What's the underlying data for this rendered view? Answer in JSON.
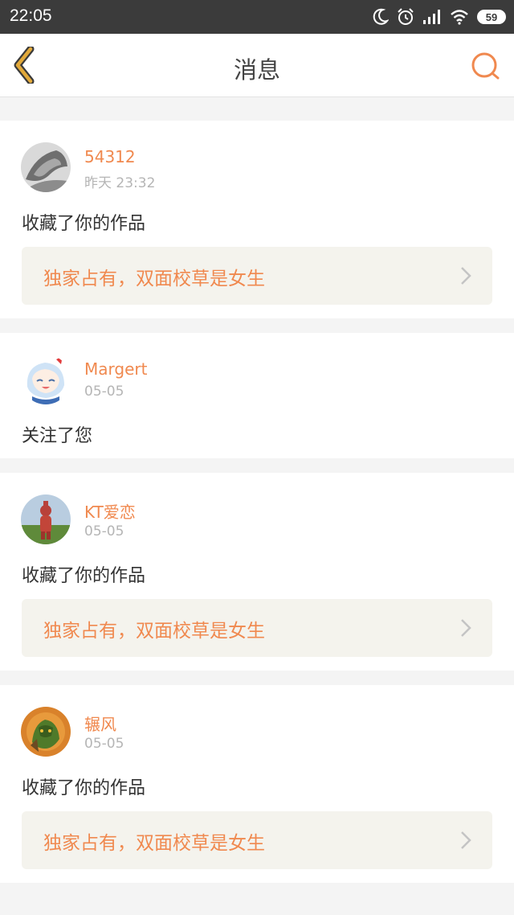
{
  "status_bar": {
    "time": "22:05",
    "icons": [
      "moon-icon",
      "alarm-icon",
      "signal-icon",
      "wifi-icon",
      "battery-icon"
    ],
    "battery": "59"
  },
  "header": {
    "title": "消息",
    "back_icon": "chevron-left-icon",
    "search_icon": "search-icon"
  },
  "colors": {
    "accent": "#f0894f",
    "back_icon": "#e2a93a",
    "secondary_text": "#b5b5b5",
    "work_bg": "#f4f3ed"
  },
  "messages": [
    {
      "user": "54312",
      "time": "昨天 23:32",
      "action": "收藏了你的作品",
      "work_title": "独家占有，双面校草是女生"
    },
    {
      "user": "Margert",
      "time": "05-05",
      "action": "关注了您"
    },
    {
      "user": "KT爱恋",
      "time": "05-05",
      "action": "收藏了你的作品",
      "work_title": "独家占有，双面校草是女生"
    },
    {
      "user": "辗风",
      "time": "05-05",
      "action": "收藏了你的作品",
      "work_title": "独家占有，双面校草是女生"
    }
  ]
}
